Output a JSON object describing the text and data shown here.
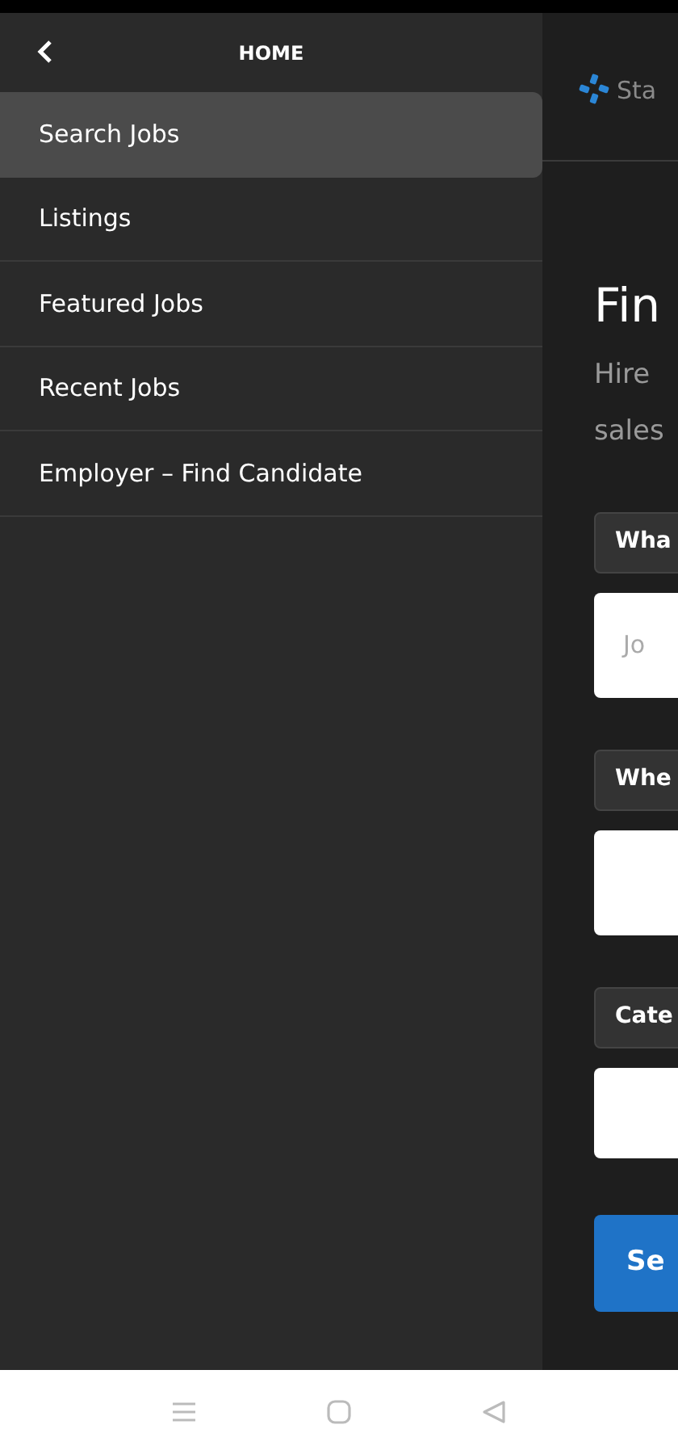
{
  "drawer": {
    "title": "HOME",
    "items": [
      {
        "label": "Search Jobs",
        "selected": true
      },
      {
        "label": "Listings",
        "selected": false
      },
      {
        "label": "Featured Jobs",
        "selected": false
      },
      {
        "label": "Recent Jobs",
        "selected": false
      },
      {
        "label": "Employer – Find Candidate",
        "selected": false
      }
    ]
  },
  "page": {
    "brand": "Sta",
    "heading": "Fin",
    "subtitle_lines": [
      "Hire",
      "sales"
    ],
    "fields": [
      {
        "label": "Wha",
        "placeholder": "Jo"
      },
      {
        "label": "Whe"
      },
      {
        "label": "Cate"
      }
    ],
    "button": "Se"
  }
}
